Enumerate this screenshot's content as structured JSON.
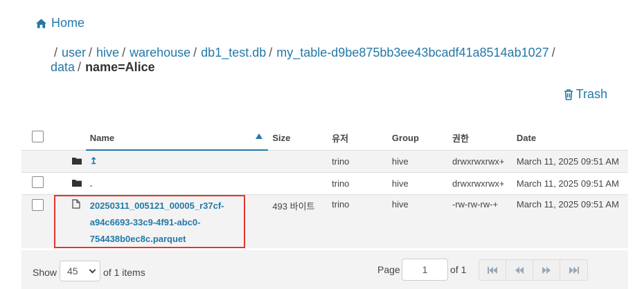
{
  "home": {
    "label": "Home"
  },
  "breadcrumb": {
    "items": [
      "user",
      "hive",
      "warehouse",
      "db1_test.db",
      "my_table-d9be875bb3ee43bcadf41a8514ab1027",
      "data"
    ],
    "current": "name=Alice"
  },
  "trash": {
    "label": "Trash"
  },
  "table": {
    "headers": {
      "name": "Name",
      "size": "Size",
      "user": "유저",
      "group": "Group",
      "perm": "권한",
      "date": "Date"
    },
    "rows": [
      {
        "name": "↥",
        "size": "",
        "user": "trino",
        "group": "hive",
        "perm": "drwxrwxrwx+",
        "date": "March 11, 2025 09:51 AM",
        "icon": "folder-icon"
      },
      {
        "name": ".",
        "size": "",
        "user": "trino",
        "group": "hive",
        "perm": "drwxrwxrwx+",
        "date": "March 11, 2025 09:51 AM",
        "icon": "folder-icon"
      },
      {
        "name_lines": [
          "20250311_005121_00005_r37cf-",
          "a94c6693-33c9-4f91-abc0-",
          "754438b0ec8c.parquet"
        ],
        "size": "493 바이트",
        "user": "trino",
        "group": "hive",
        "perm": "-rw-rw-rw-+",
        "date": "March 11, 2025 09:51 AM",
        "icon": "file-icon"
      }
    ]
  },
  "footer": {
    "show_label": "Show",
    "page_size": "45",
    "of_items": "of 1 items",
    "page_label": "Page",
    "page_value": "1",
    "of_pages": "of 1"
  }
}
